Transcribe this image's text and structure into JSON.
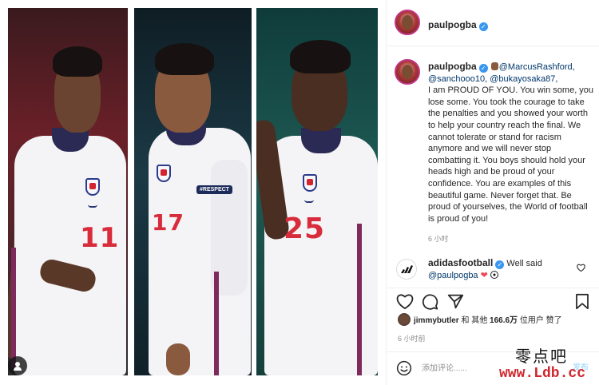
{
  "post": {
    "header_username": "paulpogba",
    "caption": {
      "username": "paulpogba",
      "mention_1": "@MarcusRashford,",
      "mention_2": "@sanchooo10,",
      "mention_3": "@bukayosaka87,",
      "body": "I am PROUD OF YOU. You win some, you lose some. You took the courage to take the penalties and you showed your worth to help your country reach the final. We cannot tolerate or stand for racism anymore and we will never stop combatting it. You boys should hold your heads high and be proud of your confidence. You are examples of this beautiful game. Never forget that. Be proud of yourselves, the World of football is proud of you!",
      "time": "6 小时"
    },
    "comment": {
      "username": "adidasfootball",
      "text": "Well said",
      "mention": "@paulpogba"
    },
    "likes": {
      "first_user": "jimmybutler",
      "connector": "和 其他",
      "count": "166.6万",
      "suffix": "位用户 赞了"
    },
    "likes_time": "6 小时前",
    "add_comment": {
      "placeholder": "添加评论......",
      "post_label": "发布"
    }
  },
  "photos": [
    {
      "kit_number": "11"
    },
    {
      "kit_number": "17",
      "badge": "#RESPECT"
    },
    {
      "kit_number": "25"
    }
  ],
  "watermark": {
    "cn": "零点吧",
    "url": "www.Ldb.cc"
  },
  "colors": {
    "accent_link": "#00376b",
    "verified": "#3897f0",
    "heart": "#ed4956",
    "kit_red": "#d82b3b"
  },
  "icons": [
    "multi-photo-icon",
    "verified-icon",
    "heart-icon",
    "comment-icon",
    "share-icon",
    "bookmark-icon",
    "smile-icon",
    "adidas-logo-icon"
  ]
}
